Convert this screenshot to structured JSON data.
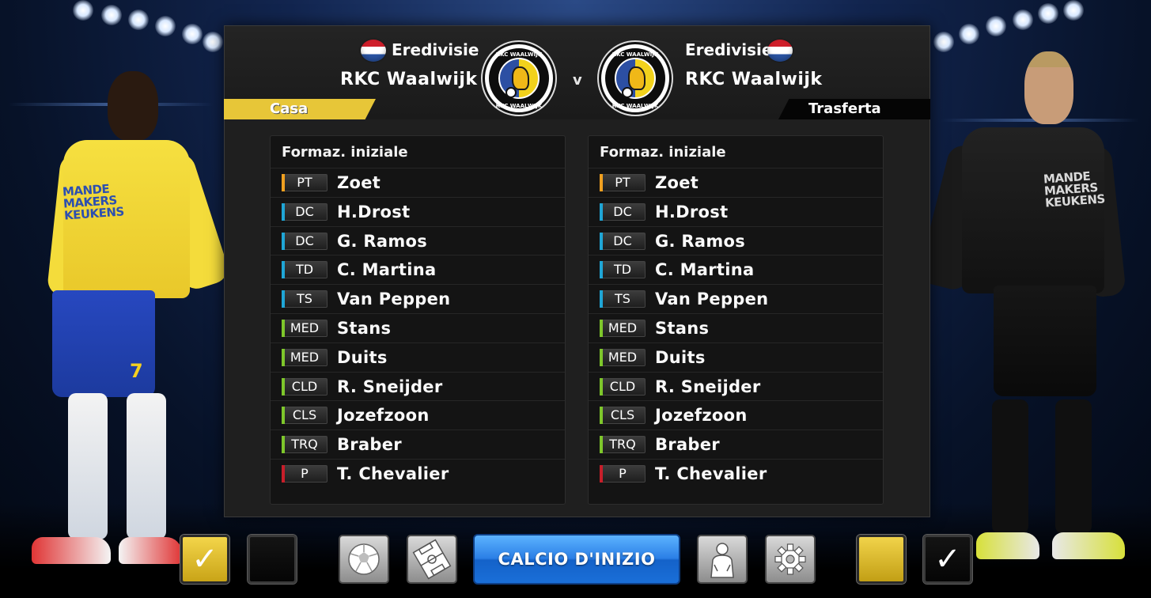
{
  "home": {
    "league": "Eredivisie",
    "team": "RKC Waalwijk",
    "side_label": "Casa",
    "crest_text_top": "RKC WAALWIJK",
    "crest_text_bottom": "RKC WAALWIJK",
    "sponsor": [
      "MANDE",
      "MAKERS",
      "KEUKENS"
    ],
    "shirt_number": "7"
  },
  "away": {
    "league": "Eredivisie",
    "team": "RKC Waalwijk",
    "side_label": "Trasferta",
    "crest_text_top": "RKC WAALWIJK",
    "crest_text_bottom": "RKC WAALWIJK",
    "sponsor": [
      "MANDE",
      "MAKERS",
      "KEUKENS"
    ]
  },
  "vs": "v",
  "lineup_title": "Formaz. iniziale",
  "position_colors": {
    "PT": "#f0a020",
    "DC": "#1fa6d6",
    "TD": "#1fa6d6",
    "TS": "#1fa6d6",
    "MED": "#7ec72b",
    "CLD": "#7ec72b",
    "CLS": "#7ec72b",
    "TRQ": "#7ec72b",
    "P": "#c81e2a"
  },
  "home_lineup": [
    {
      "pos": "PT",
      "name": "Zoet"
    },
    {
      "pos": "DC",
      "name": "H.Drost"
    },
    {
      "pos": "DC",
      "name": "G. Ramos"
    },
    {
      "pos": "TD",
      "name": "C. Martina"
    },
    {
      "pos": "TS",
      "name": "Van Peppen"
    },
    {
      "pos": "MED",
      "name": "Stans"
    },
    {
      "pos": "MED",
      "name": "Duits"
    },
    {
      "pos": "CLD",
      "name": "R. Sneijder"
    },
    {
      "pos": "CLS",
      "name": "Jozefzoon"
    },
    {
      "pos": "TRQ",
      "name": "Braber"
    },
    {
      "pos": "P",
      "name": "T. Chevalier"
    }
  ],
  "away_lineup": [
    {
      "pos": "PT",
      "name": "Zoet"
    },
    {
      "pos": "DC",
      "name": "H.Drost"
    },
    {
      "pos": "DC",
      "name": "G. Ramos"
    },
    {
      "pos": "TD",
      "name": "C. Martina"
    },
    {
      "pos": "TS",
      "name": "Van Peppen"
    },
    {
      "pos": "MED",
      "name": "Stans"
    },
    {
      "pos": "MED",
      "name": "Duits"
    },
    {
      "pos": "CLD",
      "name": "R. Sneijder"
    },
    {
      "pos": "CLS",
      "name": "Jozefzoon"
    },
    {
      "pos": "TRQ",
      "name": "Braber"
    },
    {
      "pos": "P",
      "name": "T. Chevalier"
    }
  ],
  "toolbar": {
    "kickoff_label": "CALCIO D'INIZIO",
    "home_kit_1_icon": "check-icon",
    "home_kit_2_icon": "",
    "ball_icon": "ball-icon",
    "formation_icon": "formation-icon",
    "player_icon": "player-icon",
    "settings_icon": "gear-icon",
    "away_kit_1_icon": "",
    "away_kit_2_icon": "check-icon",
    "check_glyph": "✓"
  }
}
